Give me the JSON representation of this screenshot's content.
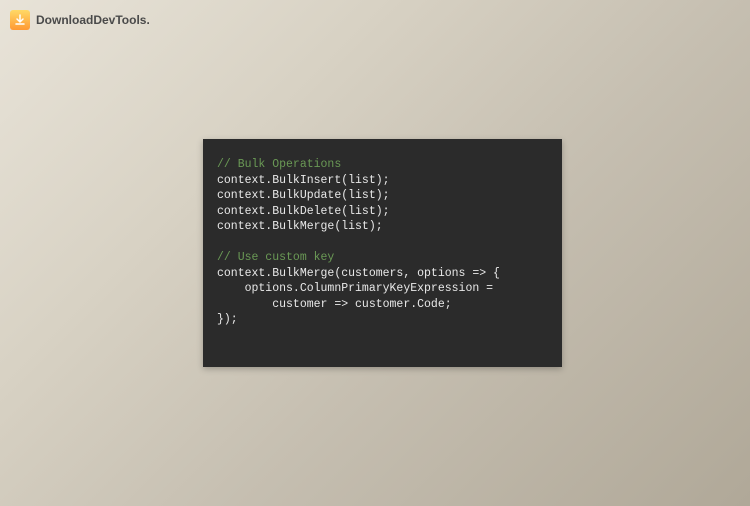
{
  "header": {
    "logo_text": "DownloadDevTools."
  },
  "code": {
    "comment1": "// Bulk Operations",
    "line1": "context.BulkInsert(list);",
    "line2": "context.BulkUpdate(list);",
    "line3": "context.BulkDelete(list);",
    "line4": "context.BulkMerge(list);",
    "comment2": "// Use custom key",
    "line5": "context.BulkMerge(customers, options => {",
    "line6": "    options.ColumnPrimaryKeyExpression = ",
    "line7": "        customer => customer.Code;",
    "line8": "});"
  }
}
